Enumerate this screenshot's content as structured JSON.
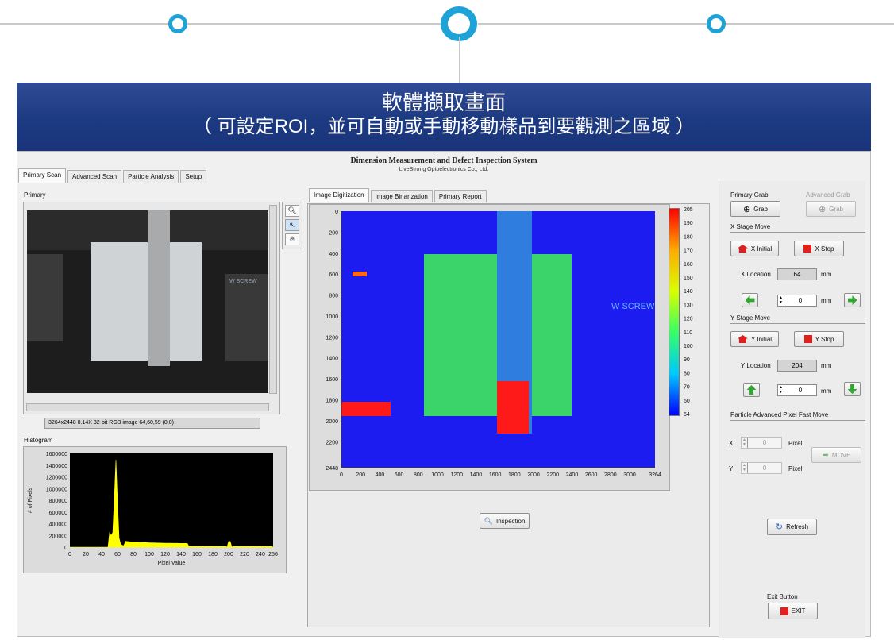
{
  "banner": {
    "title": "軟體擷取畫面",
    "subtitle": "（ 可設定ROI，並可自動或手動移動樣品到要觀測之區域 ）"
  },
  "app": {
    "title": "Dimension Measurement and Defect Inspection System",
    "subtitle": "LiveStrong Optoelectronics Co., Ltd."
  },
  "main_tabs": [
    "Primary Scan",
    "Advanced Scan",
    "Particle Analysis",
    "Setup"
  ],
  "primary": {
    "label": "Primary",
    "status": "3264x2448 0.14X 32-bit RGB image 64,60,59    (0,0)"
  },
  "histogram": {
    "label": "Histogram",
    "ylabel": "# of Pixels",
    "xlabel": "Pixel Value",
    "yticks": [
      "1600000",
      "1400000",
      "1200000",
      "1000000",
      "800000",
      "600000",
      "400000",
      "200000",
      "0"
    ],
    "xticks": [
      "0",
      "20",
      "40",
      "60",
      "80",
      "100",
      "120",
      "140",
      "160",
      "180",
      "200",
      "220",
      "240",
      "256"
    ]
  },
  "image_tabs": [
    "Image Digitization",
    "Image Binarization",
    "Primary Report"
  ],
  "digitization": {
    "yticks": [
      "0",
      "200",
      "400",
      "600",
      "800",
      "1000",
      "1200",
      "1400",
      "1600",
      "1800",
      "2000",
      "2200",
      "2448"
    ],
    "xticks": [
      "0",
      "200",
      "400",
      "600",
      "800",
      "1000",
      "1200",
      "1400",
      "1600",
      "1800",
      "2000",
      "2200",
      "2400",
      "2600",
      "2800",
      "3000",
      "3264"
    ],
    "scale": [
      "205",
      "190",
      "180",
      "170",
      "160",
      "150",
      "140",
      "130",
      "120",
      "110",
      "100",
      "90",
      "80",
      "70",
      "60",
      "54"
    ],
    "overlay_text": "W SCREW"
  },
  "inspection_button": "Inspection",
  "right": {
    "primary_grab": "Primary Grab",
    "advanced_grab": "Advanced Grab",
    "grab": "Grab",
    "x_stage": "X Stage Move",
    "x_initial": "X Initial",
    "x_stop": "X Stop",
    "x_location_label": "X Location",
    "x_location": "64",
    "mm": "mm",
    "x_step": "0",
    "y_stage": "Y Stage Move",
    "y_initial": "Y Initial",
    "y_stop": "Y Stop",
    "y_location_label": "Y Location",
    "y_location": "204",
    "y_step": "0",
    "particle": "Particle Advanced Pixel Fast Move",
    "x": "X",
    "y": "Y",
    "pixel": "Pixel",
    "x_pixel": "0",
    "y_pixel": "0",
    "move": "MOVE",
    "refresh": "Refresh",
    "exit_label": "Exit Button",
    "exit": "EXIT"
  },
  "colors": {
    "accent": "#1ea3d8",
    "banner": "#1c3a82",
    "heat_blue": "#1c1cf0",
    "heat_red": "#ff1a1a"
  }
}
